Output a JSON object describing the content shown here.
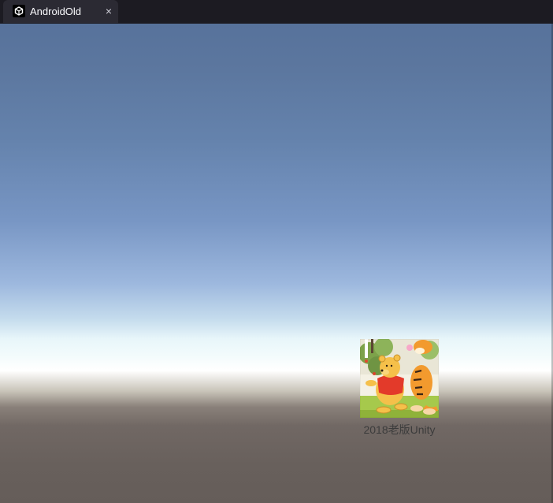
{
  "tab": {
    "title": "AndroidOld",
    "icon": "unity-logo-icon",
    "close_icon": "close-icon",
    "close_glyph": "×"
  },
  "viewport": {
    "sky_colors": [
      "#57729b",
      "#7896c4",
      "#c5dced",
      "#ffffff"
    ],
    "ground_colors": [
      "#8a817a",
      "#68605c"
    ]
  },
  "app_icon": {
    "label": "2018老版Unity",
    "image": "winnie-the-pooh-and-tigger-picture"
  }
}
